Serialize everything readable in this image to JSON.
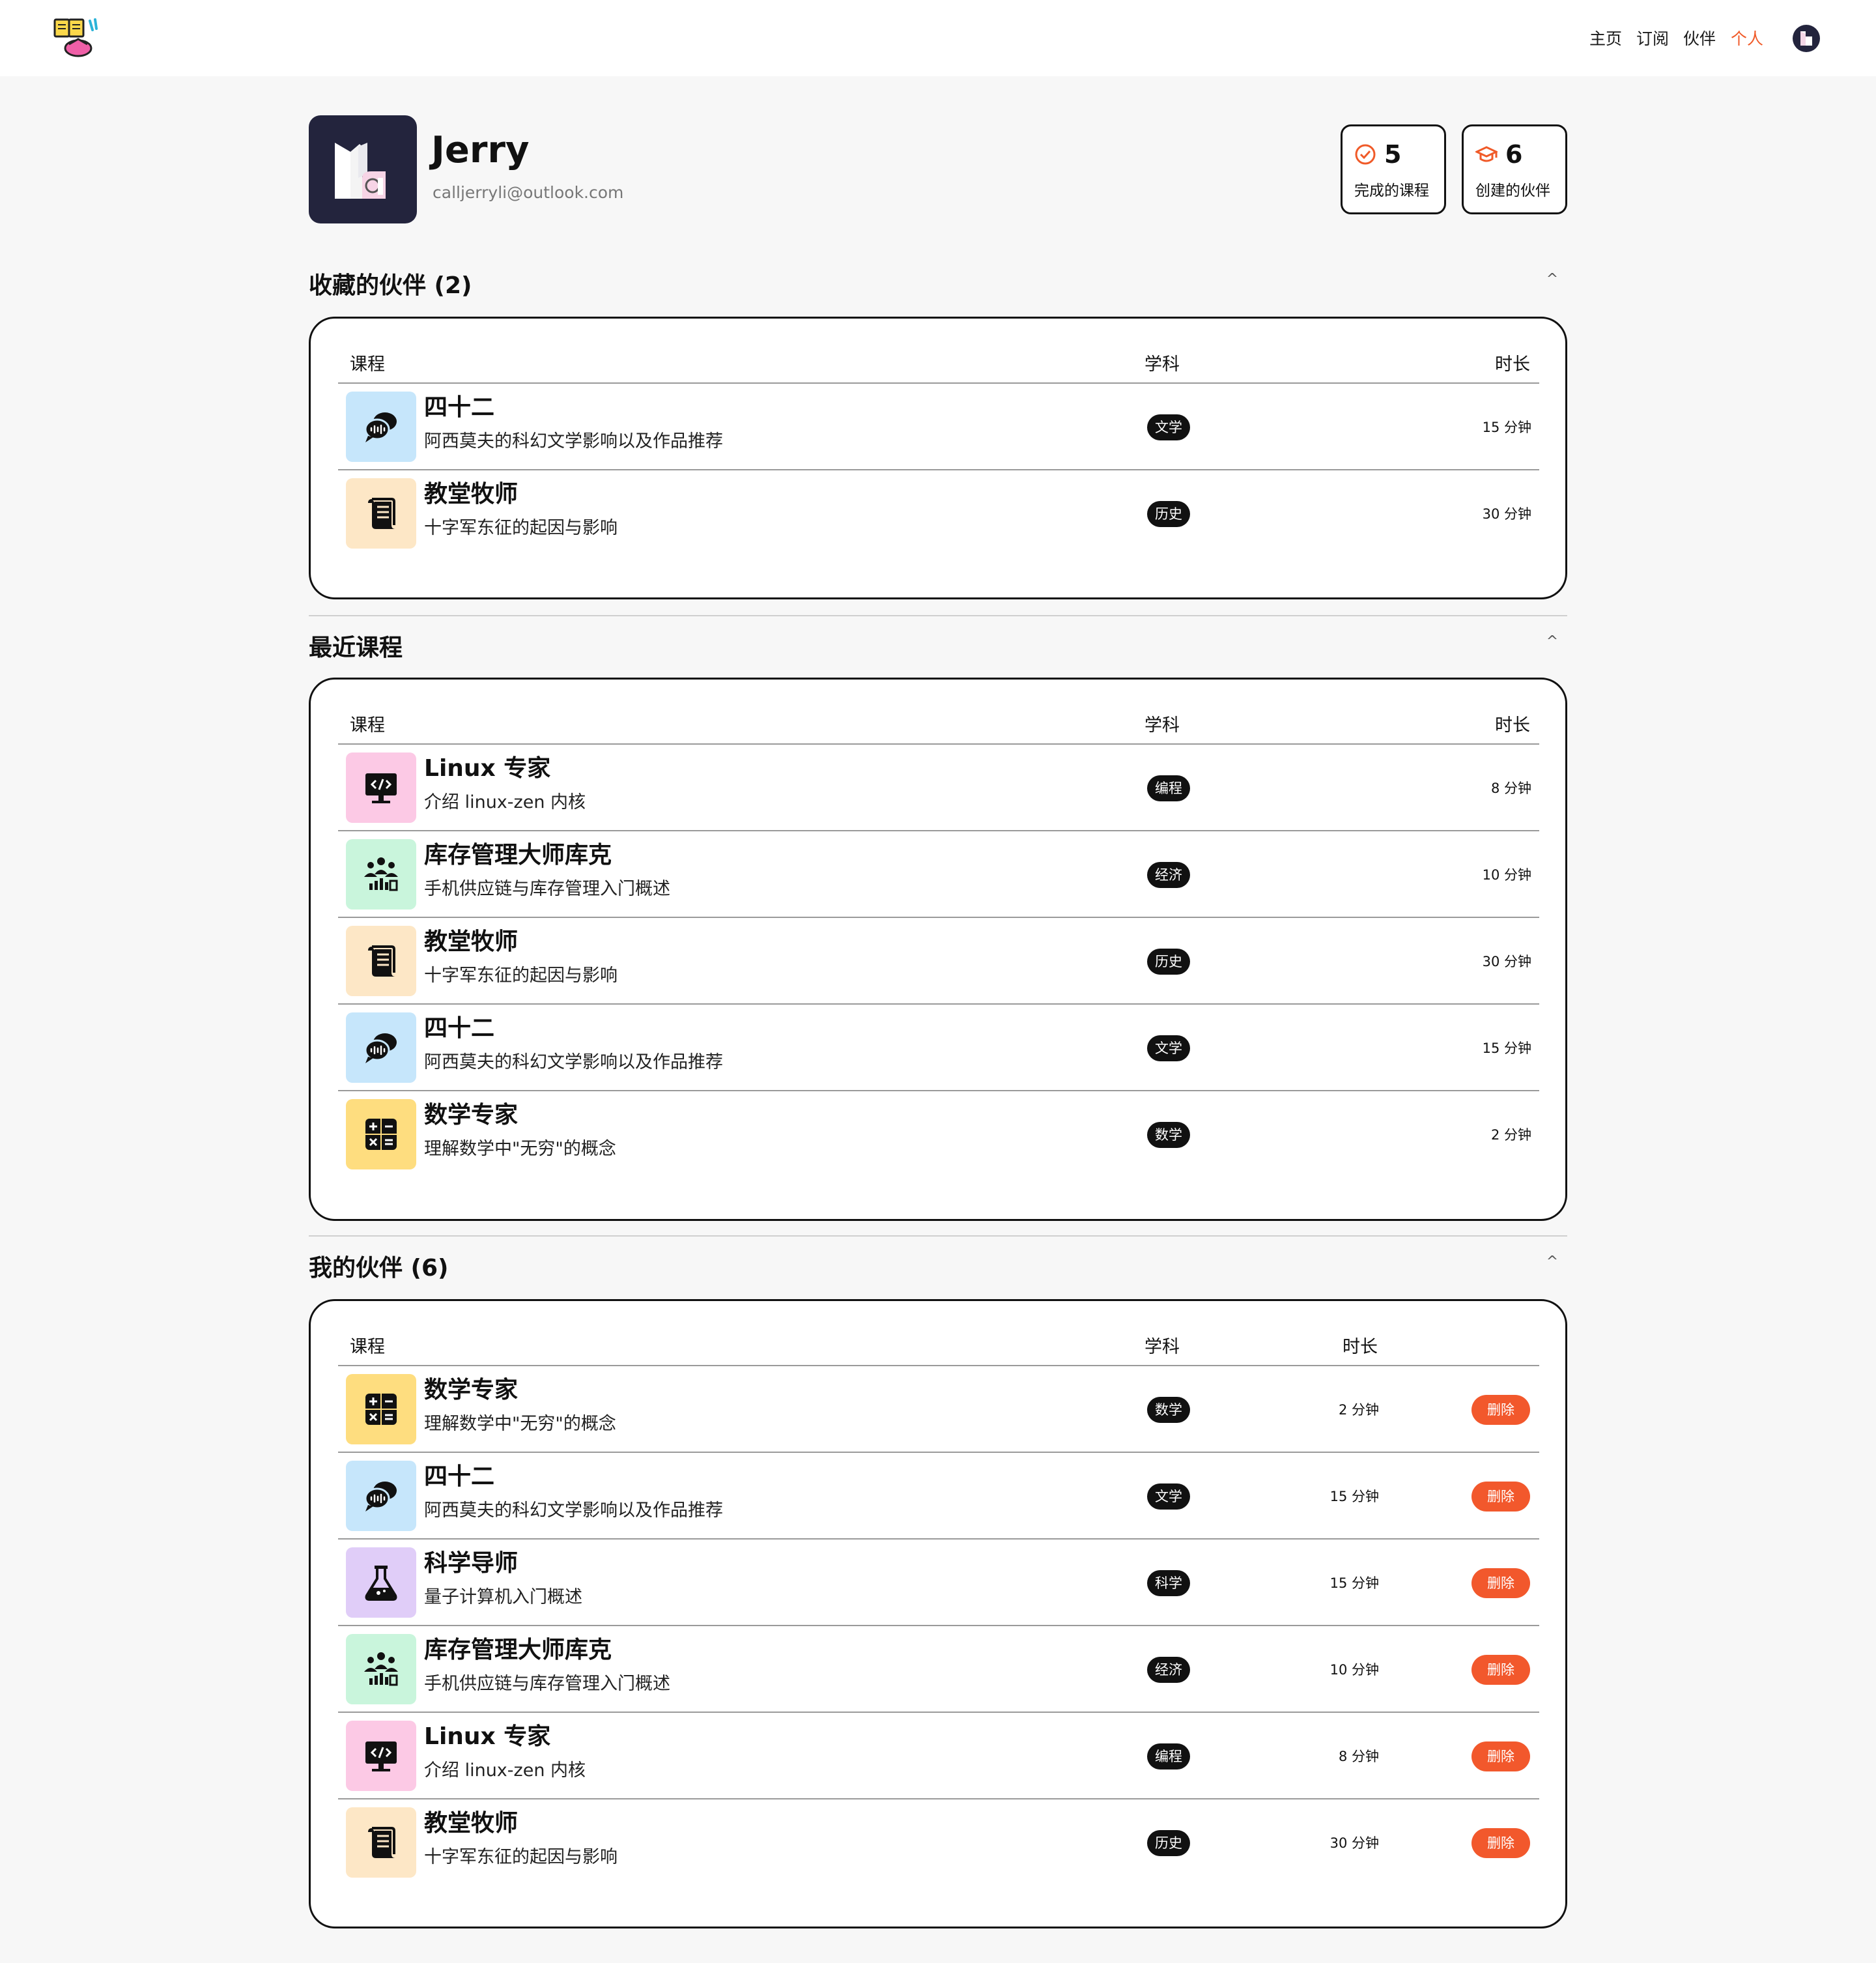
{
  "nav": {
    "home": "主页",
    "subscribe": "订阅",
    "partners": "伙伴",
    "personal": "个人"
  },
  "profile": {
    "name": "Jerry",
    "email": "calljerryli@outlook.com"
  },
  "stats": [
    {
      "value": "5",
      "label": "完成的课程",
      "icon": "check-circle-icon"
    },
    {
      "value": "6",
      "label": "创建的伙伴",
      "icon": "graduation-cap-icon"
    }
  ],
  "colors": {
    "accent": "#f05a28",
    "delete": "#f2582c",
    "avatar_bg": "#23243d",
    "icon_blue": "#c6e6fb",
    "icon_orange": "#fde7c6",
    "icon_pink": "#fcc9e5",
    "icon_green": "#c9f5dc",
    "icon_yellow": "#fedd7f",
    "icon_purple": "#e0cdf8"
  },
  "headers": {
    "course": "课程",
    "subject": "学科",
    "duration": "时长"
  },
  "sections": {
    "favorites": {
      "title": "收藏的伙伴 (2)",
      "rows": [
        {
          "title": "四十二",
          "desc": "阿西莫夫的科幻文学影响以及作品推荐",
          "subject": "文学",
          "duration": "15 分钟",
          "icon": "chat-bubbles-icon",
          "color": "blue"
        },
        {
          "title": "教堂牧师",
          "desc": "十字军东征的起因与影响",
          "subject": "历史",
          "duration": "30 分钟",
          "icon": "scroll-icon",
          "color": "orange"
        }
      ]
    },
    "recent": {
      "title": "最近课程",
      "rows": [
        {
          "title": "Linux 专家",
          "desc": "介绍 linux-zen 内核",
          "subject": "编程",
          "duration": "8 分钟",
          "icon": "code-monitor-icon",
          "color": "pink"
        },
        {
          "title": "库存管理大师库克",
          "desc": "手机供应链与库存管理入门概述",
          "subject": "经济",
          "duration": "10 分钟",
          "icon": "team-chart-icon",
          "color": "green"
        },
        {
          "title": "教堂牧师",
          "desc": "十字军东征的起因与影响",
          "subject": "历史",
          "duration": "30 分钟",
          "icon": "scroll-icon",
          "color": "orange"
        },
        {
          "title": "四十二",
          "desc": "阿西莫夫的科幻文学影响以及作品推荐",
          "subject": "文学",
          "duration": "15 分钟",
          "icon": "chat-bubbles-icon",
          "color": "blue"
        },
        {
          "title": "数学专家",
          "desc": "理解数学中\"无穷\"的概念",
          "subject": "数学",
          "duration": "2 分钟",
          "icon": "calculator-icon",
          "color": "yellow"
        }
      ]
    },
    "mine": {
      "title": "我的伙伴 (6)",
      "delete_label": "删除",
      "rows": [
        {
          "title": "数学专家",
          "desc": "理解数学中\"无穷\"的概念",
          "subject": "数学",
          "duration": "2 分钟",
          "icon": "calculator-icon",
          "color": "yellow"
        },
        {
          "title": "四十二",
          "desc": "阿西莫夫的科幻文学影响以及作品推荐",
          "subject": "文学",
          "duration": "15 分钟",
          "icon": "chat-bubbles-icon",
          "color": "blue"
        },
        {
          "title": "科学导师",
          "desc": "量子计算机入门概述",
          "subject": "科学",
          "duration": "15 分钟",
          "icon": "flask-icon",
          "color": "purple"
        },
        {
          "title": "库存管理大师库克",
          "desc": "手机供应链与库存管理入门概述",
          "subject": "经济",
          "duration": "10 分钟",
          "icon": "team-chart-icon",
          "color": "green"
        },
        {
          "title": "Linux 专家",
          "desc": "介绍 linux-zen 内核",
          "subject": "编程",
          "duration": "8 分钟",
          "icon": "code-monitor-icon",
          "color": "pink"
        },
        {
          "title": "教堂牧师",
          "desc": "十字军东征的起因与影响",
          "subject": "历史",
          "duration": "30 分钟",
          "icon": "scroll-icon",
          "color": "orange"
        }
      ]
    }
  }
}
